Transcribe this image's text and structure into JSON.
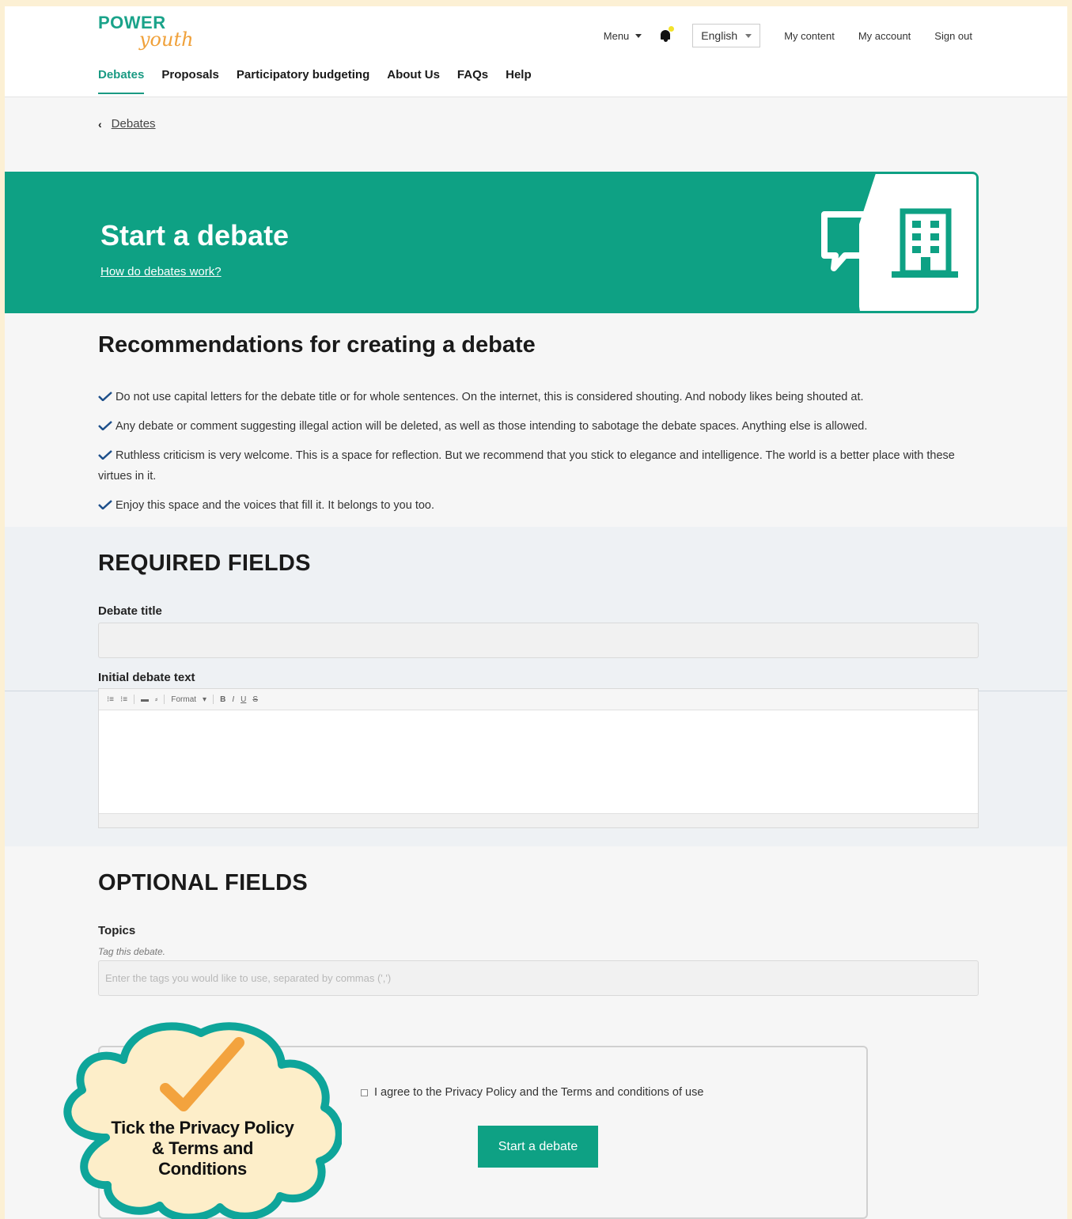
{
  "header": {
    "logo": {
      "power": "POWER",
      "youth": "youth"
    },
    "util": {
      "menu": "Menu",
      "language": "English",
      "my_content": "My content",
      "my_account": "My account",
      "sign_out": "Sign out"
    },
    "nav": [
      "Debates",
      "Proposals",
      "Participatory budgeting",
      "About Us",
      "FAQs",
      "Help"
    ],
    "active_nav": "Debates"
  },
  "breadcrumb": {
    "label": "Debates"
  },
  "banner": {
    "title": "Start a debate",
    "link": "How do debates work?",
    "color": "#0ea184"
  },
  "recommendations": {
    "title": "Recommendations for creating a debate",
    "items": [
      "Do not use capital letters for the debate title or for whole sentences. On the internet, this is considered shouting. And nobody likes being shouted at.",
      "Any debate or comment suggesting illegal action will be deleted, as well as those intending to sabotage the debate spaces. Anything else is allowed.",
      "Ruthless criticism is very welcome. This is a space for reflection. But we recommend that you stick to elegance and intelligence. The world is a better place with these virtues in it.",
      "Enjoy this space and the voices that fill it. It belongs to you too."
    ]
  },
  "required": {
    "title": "REQUIRED FIELDS",
    "debate_title_label": "Debate title",
    "debate_title_value": "",
    "initial_text_label": "Initial debate text",
    "toolbar": {
      "format": "Format",
      "bold": "B",
      "italic": "I",
      "underline": "U",
      "strike": "S"
    }
  },
  "optional": {
    "title": "OPTIONAL FIELDS",
    "topics_label": "Topics",
    "topics_hint": "Tag this debate.",
    "topics_placeholder": "Enter the tags you would like to use, separated by commas (',')"
  },
  "submit": {
    "agree_text": "I agree to the Privacy Policy and the Terms and conditions of use",
    "agree_checked": false,
    "button": "Start a debate"
  },
  "callout": {
    "line1": "Tick the Privacy Policy",
    "line2": "& Terms and",
    "line3": "Conditions",
    "cloud_color": "#fdeec9",
    "outline_color": "#0ea59a",
    "check_color": "#f3a33e"
  },
  "icons": {
    "back": "chevron-left-icon",
    "bell": "bell-icon",
    "check": "checkmark-icon",
    "speech": "speech-bubble-icon",
    "building": "building-icon"
  }
}
